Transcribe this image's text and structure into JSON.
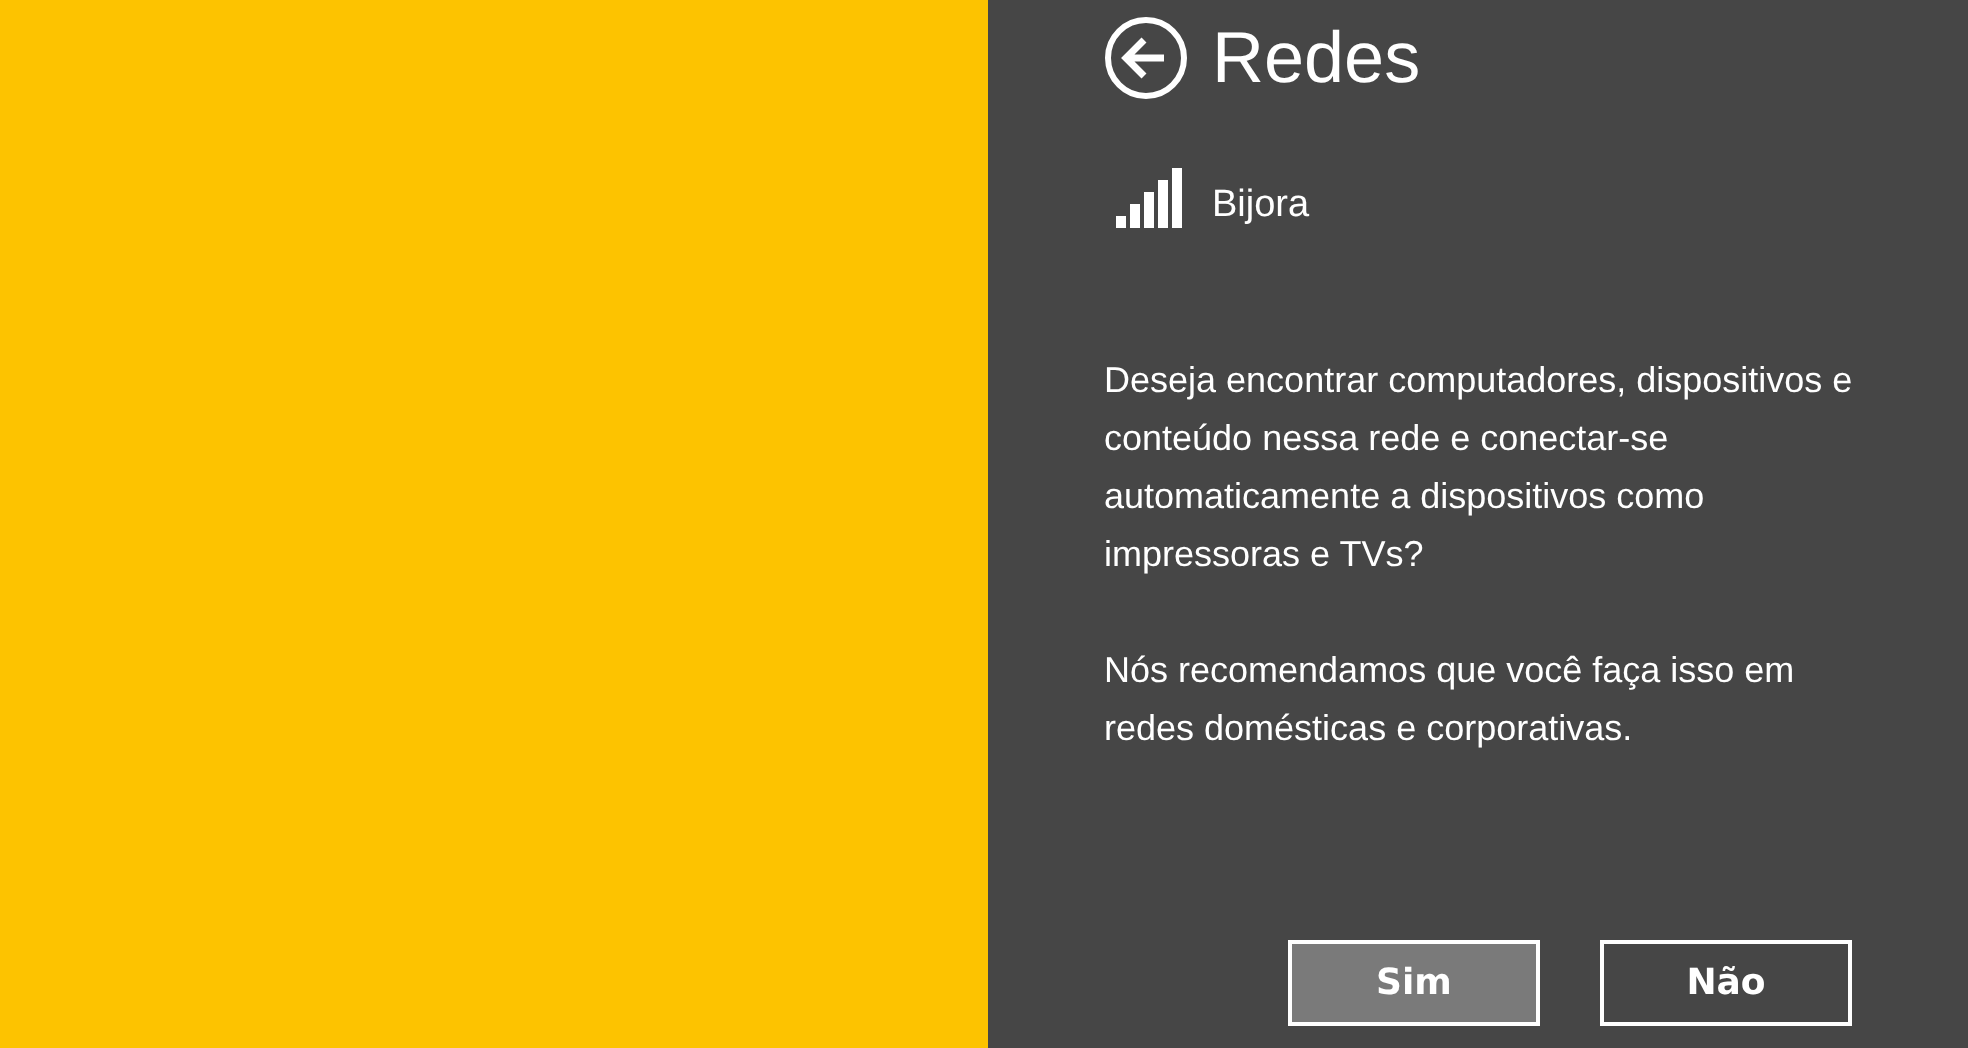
{
  "panel": {
    "title": "Redes"
  },
  "network": {
    "name": "Bijora"
  },
  "paragraphs": [
    "Deseja encontrar computadores, dispositivos e conteúdo nessa rede e conectar-se automaticamente a dispositivos como impressoras e TVs?",
    "Nós recomendamos que você faça isso em redes domésticas e corporativas."
  ],
  "buttons": [
    {
      "label": "Sim",
      "selected": true
    },
    {
      "label": "Não",
      "selected": false
    }
  ]
}
